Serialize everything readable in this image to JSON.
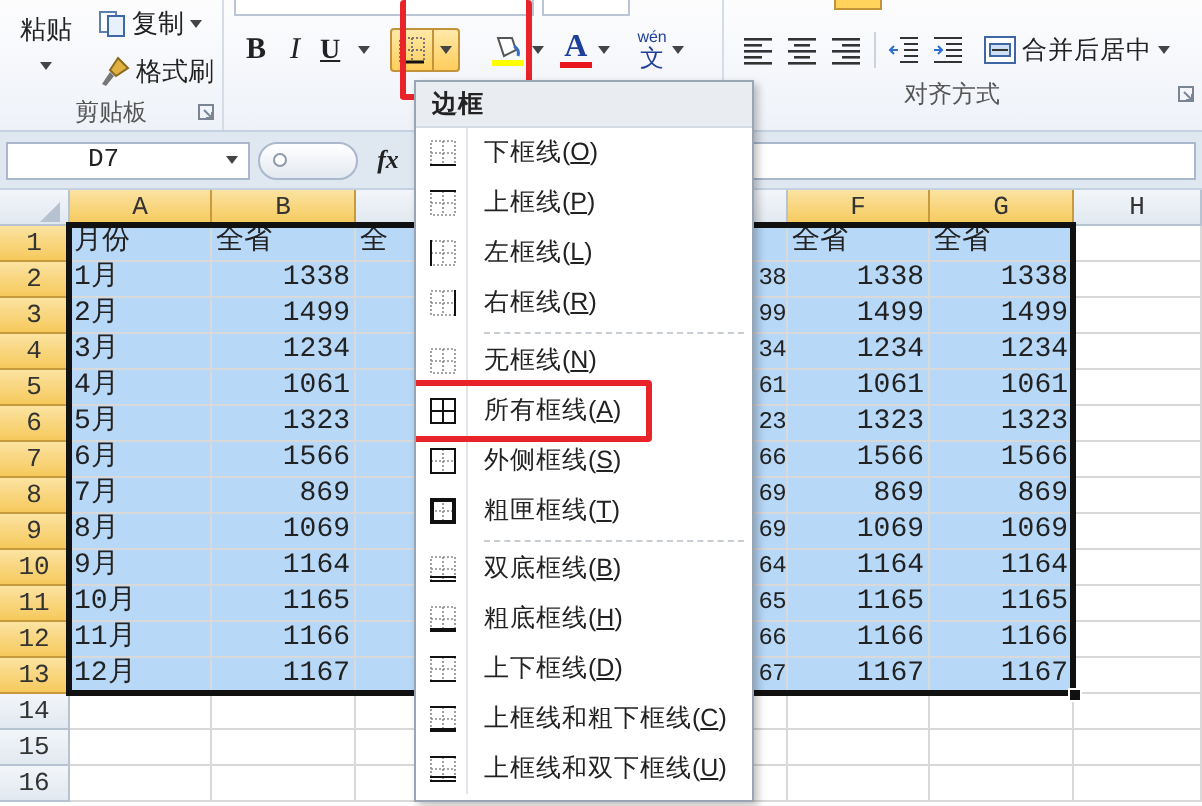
{
  "ribbon": {
    "clipboard": {
      "paste": "粘贴",
      "copy": "复制",
      "format_painter": "格式刷",
      "label": "剪贴板"
    },
    "font": {
      "bold": "B",
      "italic": "I",
      "underline": "U",
      "border_button": {
        "active": true,
        "annotated": true
      },
      "font_color": "A",
      "phonetic_top": "wén",
      "phonetic_glyph": "文"
    },
    "alignment": {
      "merge_center": "合并后居中",
      "label": "对齐方式"
    }
  },
  "formula_bar": {
    "name_box": "D7",
    "function_glyph": "fx"
  },
  "sheet": {
    "column_headers": {
      "a": {
        "label": "A",
        "selected": true
      },
      "b": {
        "label": "B",
        "selected": true
      },
      "f": {
        "label": "F",
        "selected": true
      },
      "g": {
        "label": "G",
        "selected": true
      },
      "h": {
        "label": "H",
        "selected": false
      }
    },
    "rows": [
      {
        "number": "1",
        "selected": true,
        "kind": "header",
        "cells": {
          "a": "月份",
          "b": "全省",
          "c": "全",
          "f": "全省",
          "g": "全省"
        }
      },
      {
        "number": "2",
        "selected": true,
        "kind": "data",
        "cells": {
          "a": "1月",
          "b": "1338",
          "e": "38",
          "f": "1338",
          "g": "1338"
        }
      },
      {
        "number": "3",
        "selected": true,
        "kind": "data",
        "cells": {
          "a": "2月",
          "b": "1499",
          "e": "99",
          "f": "1499",
          "g": "1499"
        }
      },
      {
        "number": "4",
        "selected": true,
        "kind": "data",
        "cells": {
          "a": "3月",
          "b": "1234",
          "e": "34",
          "f": "1234",
          "g": "1234"
        }
      },
      {
        "number": "5",
        "selected": true,
        "kind": "data",
        "cells": {
          "a": "4月",
          "b": "1061",
          "e": "61",
          "f": "1061",
          "g": "1061"
        }
      },
      {
        "number": "6",
        "selected": true,
        "kind": "data",
        "cells": {
          "a": "5月",
          "b": "1323",
          "e": "23",
          "f": "1323",
          "g": "1323"
        }
      },
      {
        "number": "7",
        "selected": true,
        "kind": "data",
        "cells": {
          "a": "6月",
          "b": "1566",
          "e": "66",
          "f": "1566",
          "g": "1566"
        }
      },
      {
        "number": "8",
        "selected": true,
        "kind": "data",
        "cells": {
          "a": "7月",
          "b": "869",
          "e": "69",
          "f": "869",
          "g": "869"
        }
      },
      {
        "number": "9",
        "selected": true,
        "kind": "data",
        "cells": {
          "a": "8月",
          "b": "1069",
          "e": "69",
          "f": "1069",
          "g": "1069"
        }
      },
      {
        "number": "10",
        "selected": true,
        "kind": "data",
        "cells": {
          "a": "9月",
          "b": "1164",
          "e": "64",
          "f": "1164",
          "g": "1164"
        }
      },
      {
        "number": "11",
        "selected": true,
        "kind": "data",
        "cells": {
          "a": "10月",
          "b": "1165",
          "e": "65",
          "f": "1165",
          "g": "1165"
        }
      },
      {
        "number": "12",
        "selected": true,
        "kind": "data",
        "cells": {
          "a": "11月",
          "b": "1166",
          "e": "66",
          "f": "1166",
          "g": "1166"
        }
      },
      {
        "number": "13",
        "selected": true,
        "kind": "data",
        "cells": {
          "a": "12月",
          "b": "1167",
          "e": "67",
          "f": "1167",
          "g": "1167"
        }
      },
      {
        "number": "14",
        "selected": false,
        "kind": "data"
      },
      {
        "number": "15",
        "selected": false,
        "kind": "data"
      },
      {
        "number": "16",
        "selected": false,
        "kind": "data"
      }
    ]
  },
  "border_menu": {
    "title": "边框",
    "items": [
      {
        "label": "下框线(O)",
        "kind": "bottom",
        "separator_above": false,
        "annotated": false
      },
      {
        "label": "上框线(P)",
        "kind": "top",
        "separator_above": false,
        "annotated": false
      },
      {
        "label": "左框线(L)",
        "kind": "left",
        "separator_above": false,
        "annotated": false
      },
      {
        "label": "右框线(R)",
        "kind": "right",
        "separator_above": false,
        "annotated": false
      },
      {
        "label": "无框线(N)",
        "kind": "none",
        "separator_above": true,
        "annotated": false
      },
      {
        "label": "所有框线(A)",
        "kind": "all",
        "separator_above": false,
        "annotated": true
      },
      {
        "label": "外侧框线(S)",
        "kind": "outside",
        "separator_above": false,
        "annotated": false
      },
      {
        "label": "粗匣框线(T)",
        "kind": "thick-box",
        "separator_above": false,
        "annotated": false
      },
      {
        "label": "双底框线(B)",
        "kind": "double-bottom",
        "separator_above": true,
        "annotated": false
      },
      {
        "label": "粗底框线(H)",
        "kind": "thick-bottom",
        "separator_above": false,
        "annotated": false
      },
      {
        "label": "上下框线(D)",
        "kind": "top-bottom",
        "separator_above": false,
        "annotated": false
      },
      {
        "label": "上框线和粗下框线(C)",
        "kind": "top-thick-bottom",
        "separator_above": false,
        "annotated": false
      },
      {
        "label": "上框线和双下框线(U)",
        "kind": "top-double-bottom",
        "separator_above": false,
        "annotated": false
      }
    ]
  }
}
